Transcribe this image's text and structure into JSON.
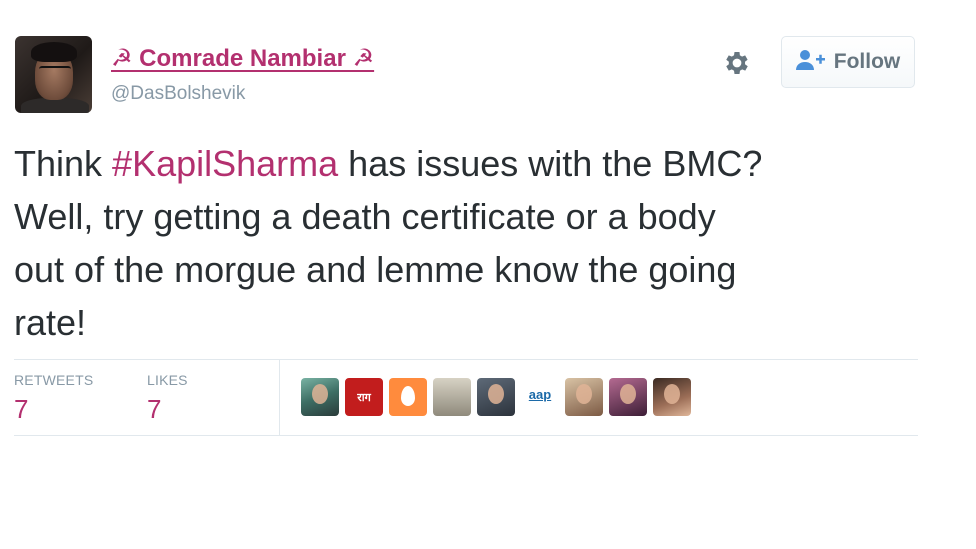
{
  "author": {
    "name": "☭ Comrade Nambiar ☭",
    "handle": "@DasBolshevik"
  },
  "follow_button": {
    "label": "Follow"
  },
  "tweet": {
    "line1_before": "Think ",
    "hashtag": "#KapilSharma",
    "line1_after": " has issues with the BMC?",
    "line2": "Well, try getting a death certificate or a body",
    "line3": "out of the morgue and lemme know the going",
    "line4": "rate!"
  },
  "stats": {
    "retweets_label": "RETWEETS",
    "retweets_value": "7",
    "likes_label": "LIKES",
    "likes_value": "7"
  },
  "likers": [
    {
      "avatar": "liker-avatar-1"
    },
    {
      "avatar": "liker-avatar-2",
      "text": "राग"
    },
    {
      "avatar": "liker-avatar-3-egg"
    },
    {
      "avatar": "liker-avatar-4"
    },
    {
      "avatar": "liker-avatar-5"
    },
    {
      "avatar": "liker-avatar-6",
      "text": "aap"
    },
    {
      "avatar": "liker-avatar-7"
    },
    {
      "avatar": "liker-avatar-8"
    },
    {
      "avatar": "liker-avatar-9"
    }
  ],
  "colors": {
    "accent": "#b3306f",
    "text": "#292f33",
    "muted": "#8899a6",
    "border": "#e1e8ed"
  },
  "icons": {
    "settings": "gear-icon",
    "follow": "add-user-icon"
  }
}
